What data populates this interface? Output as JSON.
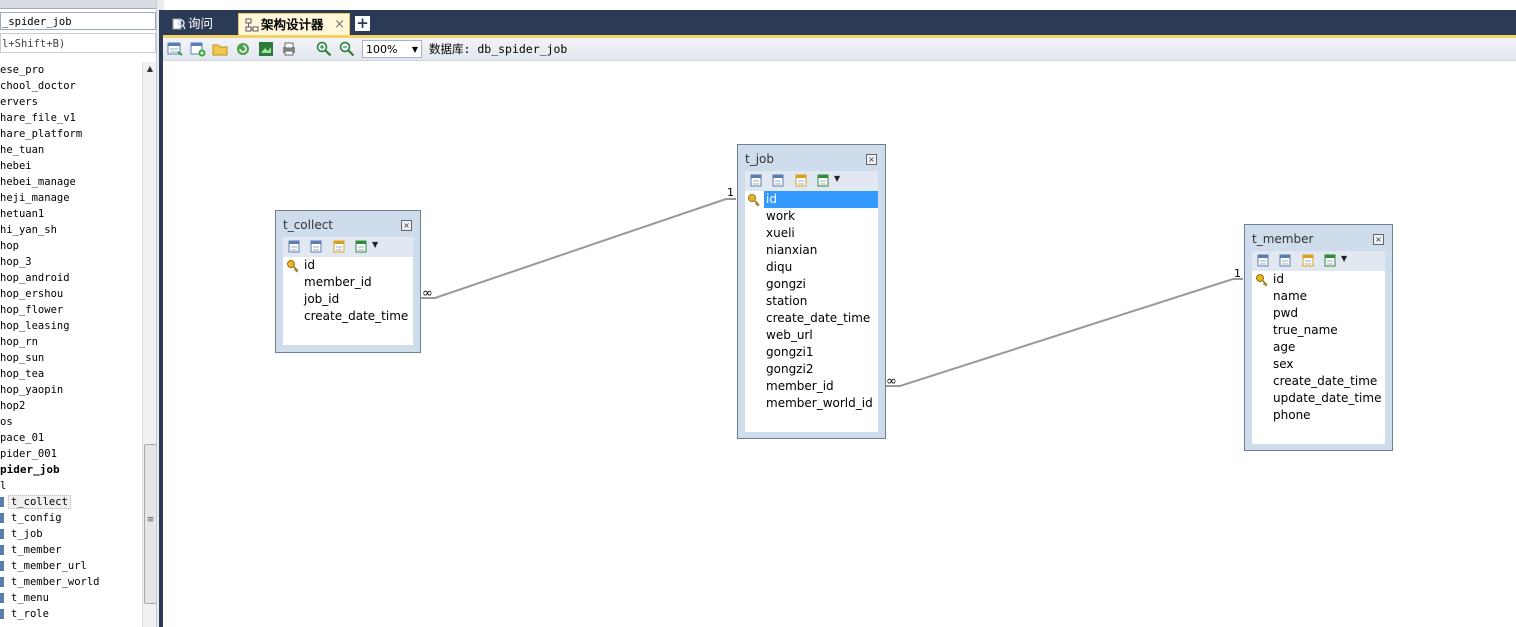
{
  "sidebar": {
    "title": "_spider_job",
    "filter_hint": "l+Shift+B)",
    "databases": [
      "ese_pro",
      "chool_doctor",
      "ervers",
      "hare_file_v1",
      "hare_platform",
      "he_tuan",
      "hebei",
      "hebei_manage",
      "heji_manage",
      "hetuan1",
      "hi_yan_sh",
      "hop",
      "hop_3",
      "hop_android",
      "hop_ershou",
      "hop_flower",
      "hop_leasing",
      "hop_rn",
      "hop_sun",
      "hop_tea",
      "hop_yaopin",
      "hop2",
      "os",
      "pace_01",
      "pider_001"
    ],
    "current_db": "pider_job",
    "tables_group": "l",
    "tables": [
      "t_collect",
      "t_config",
      "t_job",
      "t_member",
      "t_member_url",
      "t_member_world",
      "t_menu",
      "t_role"
    ],
    "selected_table": "t_collect"
  },
  "tabs": {
    "query_label": "询问",
    "designer_label": "架构设计器",
    "close_glyph": "×",
    "add_glyph": "+"
  },
  "toolbar": {
    "zoom": "100%",
    "db_label": "数据库: db_spider_job"
  },
  "diagram": {
    "entities": {
      "t_collect": {
        "name": "t_collect",
        "fields": [
          "id",
          "member_id",
          "job_id",
          "create_date_time"
        ]
      },
      "t_job": {
        "name": "t_job",
        "fields": [
          "id",
          "work",
          "xueli",
          "nianxian",
          "diqu",
          "gongzi",
          "station",
          "create_date_time",
          "web_url",
          "gongzi1",
          "gongzi2",
          "member_id",
          "member_world_id"
        ],
        "selected_field": "id"
      },
      "t_member": {
        "name": "t_member",
        "fields": [
          "id",
          "name",
          "pwd",
          "true_name",
          "age",
          "sex",
          "create_date_time",
          "update_date_time",
          "phone"
        ]
      }
    },
    "relations": [
      {
        "from": "t_collect",
        "to": "t_job",
        "from_card": "∞",
        "to_card": "1"
      },
      {
        "from": "t_job",
        "to": "t_member",
        "from_card": "∞",
        "to_card": "1"
      }
    ],
    "colors": {
      "header": "#cfdcec",
      "border": "#6d7f99",
      "selected": "#3399ff",
      "tab_bar": "#2b3a55",
      "active_tab": "#fff8d8"
    }
  }
}
